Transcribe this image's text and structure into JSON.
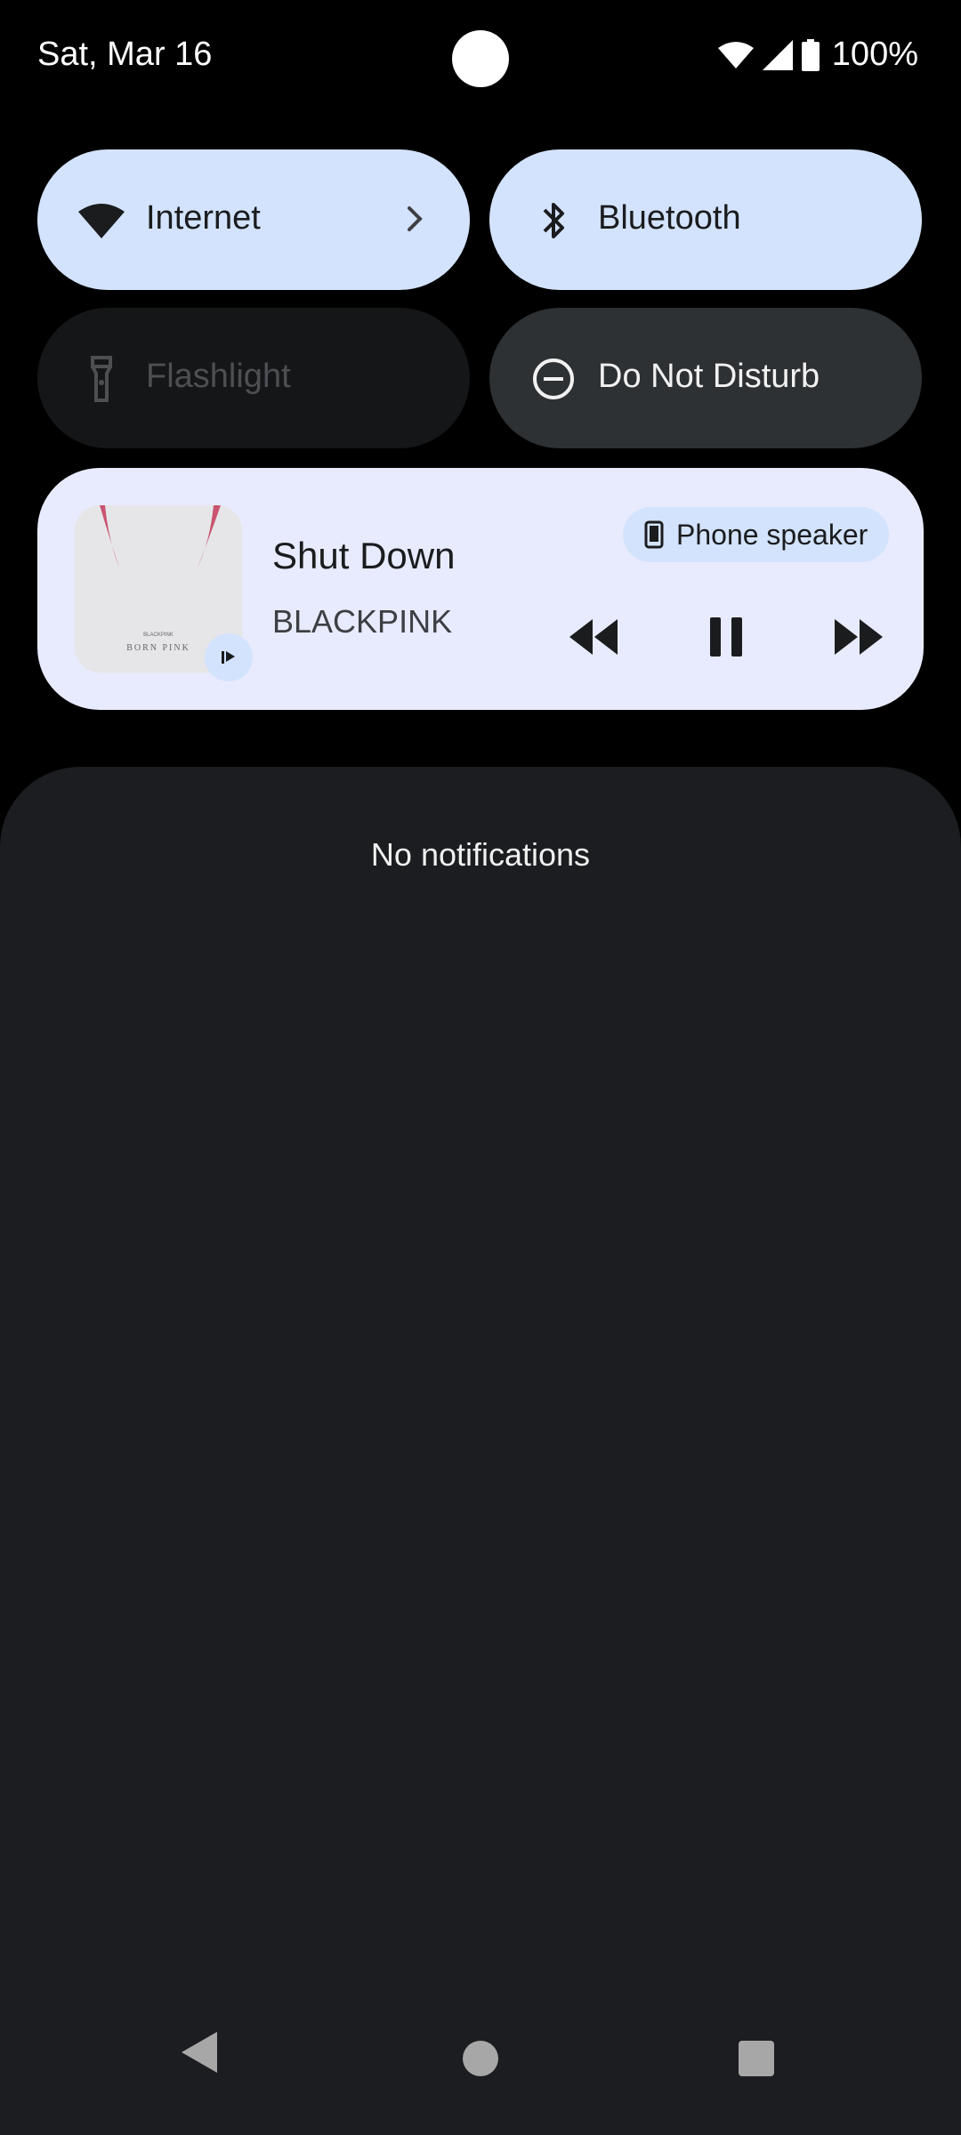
{
  "status_bar": {
    "date": "Sat, Mar 16",
    "battery_percent": "100%"
  },
  "tiles": {
    "internet": {
      "label": "Internet",
      "icon": "wifi-icon",
      "state": "on"
    },
    "bluetooth": {
      "label": "Bluetooth",
      "icon": "bluetooth-icon",
      "state": "on"
    },
    "flashlight": {
      "label": "Flashlight",
      "icon": "flashlight-icon",
      "state": "unavailable"
    },
    "dnd": {
      "label": "Do Not Disturb",
      "icon": "do-not-disturb-icon",
      "state": "off"
    }
  },
  "media": {
    "title": "Shut Down",
    "artist": "BLACKPINK",
    "output": "Phone speaker",
    "album_art_text": "BORN PINK",
    "album_art_small": "BLACKPINK",
    "state": "playing"
  },
  "shade": {
    "empty_text": "No notifications"
  },
  "colors": {
    "tile_active": "#d3e3fd",
    "tile_inactive": "#2d3134",
    "media_bg": "#e8ebfd",
    "shade_bg": "#1b1d20"
  }
}
